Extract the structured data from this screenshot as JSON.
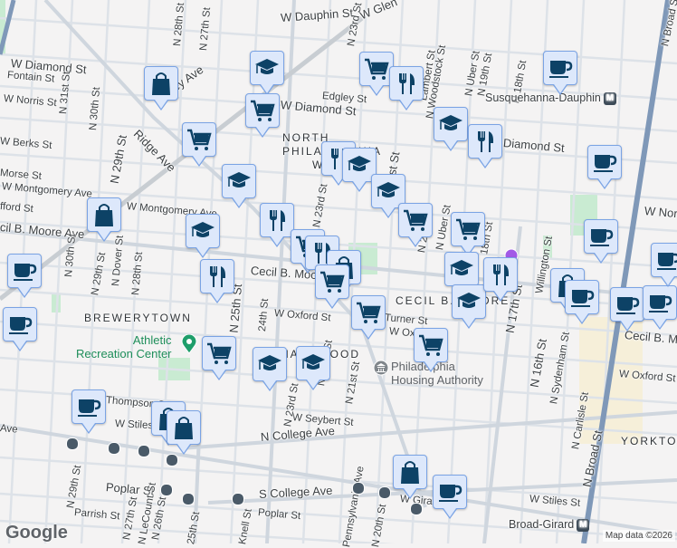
{
  "streets": {
    "w_dauphin": "W Dauphin St",
    "w_glenwood": "W Glen",
    "w_diamond_w": "W Diamond St",
    "w_diamond_c": "W Diamond St",
    "w_diamond_e": "Diamond St",
    "fontain": "Fontain St",
    "w_norris": "W Norris St",
    "w_norris_e": "W Nor",
    "w_berks": "W Berks St",
    "morse": "Morse St",
    "w_montgomery_w": "W Montgomery Ave",
    "w_montgomery_c": "W Montgomery Ave",
    "oxford_w": "fford St",
    "cecil_w": "cil B. Moore Ave",
    "cecil_c": "Cecil B. Moo",
    "cecil_cap": "CECIL B. MOORE",
    "cecil_e": "Cecil B. M",
    "w_oxford_c": "W Oxford St",
    "w_oxford_e": "W Oxford St",
    "w_oxford_2": "W Oxf",
    "turner": "Turner St",
    "thompson": "Thompson St",
    "w_stiles_w": "W Stiles St",
    "w_stiles_e": "W Stiles St",
    "w_seybert": "W Seybert St",
    "n_college": "N College Ave",
    "s_college": "S College Ave",
    "poplar_w": "Poplar St",
    "poplar_e": "Poplar St",
    "parrish": "Parrish St",
    "w_girard": "W Gira",
    "girard_w": "Ave",
    "ridge": "Ridge Ave",
    "w_lehigh": "W    gley Ave",
    "edgley": "Edgley St",
    "n_29th": "N 29th St",
    "n_29th_s": "N 29th St",
    "n_28th": "N 28th St",
    "n_28th_s": "N 28th St",
    "n_27th": "N 27th St",
    "n_31st": "N 31st St",
    "n_30th": "N 30th St",
    "n_30th_s": "N 30th St",
    "n_dover": "N Dover St",
    "n_25th": "N 25th St",
    "n_24th": "24th St",
    "n_23rd": "N 23rd St",
    "n_23rd_n": "N 23rd St",
    "n_22nd": "N 22nd St",
    "n_21st": "21st St",
    "n_21st_s": "N 21st St",
    "n_20th": "N 20th St",
    "n_20th_s": "N 20th St",
    "n_uber": "N Uber St",
    "n_uber_s": "N Uber St",
    "n_19th": "N 19th St",
    "n_18th": "N 18th St",
    "n_18th_s": "18th St",
    "n_17th": "N 17th St",
    "n_16th": "N 16th St",
    "n_woodstock": "N Woodstock St",
    "n_lambert": "Lambert St",
    "n_sydenham": "N Sydenham St",
    "n_carlisle": "N Carlisle St",
    "n_broad": "N Broad St",
    "n_broad_n": "N Broad St",
    "willington": "Willington St",
    "n_26th": "N 26th St",
    "n_27th_s": "N 27th St",
    "lecount": "N LeCount St",
    "n_25th_s": "25th St",
    "knell": "Knell St",
    "penn_ave": "Pennsylvania Ave",
    "n_20th_bottom": "N 20th St"
  },
  "neighborhoods": {
    "north_philly_1": "NORTH",
    "north_philly_2": "PHILADELPHIA",
    "north_philly_3": "WEST",
    "brewerytown": "BREWERYTOWN",
    "sharswood": "SHARSWOOD",
    "yorktown": "YORKTOWN"
  },
  "places": {
    "athletic_1": "Athletic",
    "athletic_2": "Recreation Center",
    "pha_1": "Philadelphia",
    "pha_2": "Housing Authority"
  },
  "transit": {
    "susquehanna": "Susquehanna-Dauphin",
    "broad_girard": "Broad-Girard",
    "metro_symbol": "M"
  },
  "footer": {
    "google": "Google",
    "attribution": "Map data ©2026"
  },
  "colors": {
    "marker_bg": "#dde8fb",
    "marker_border": "#7aa3e4",
    "marker_icon": "#0d4266",
    "broad_line": "#7f98b8",
    "park": "#b7e4c7"
  }
}
